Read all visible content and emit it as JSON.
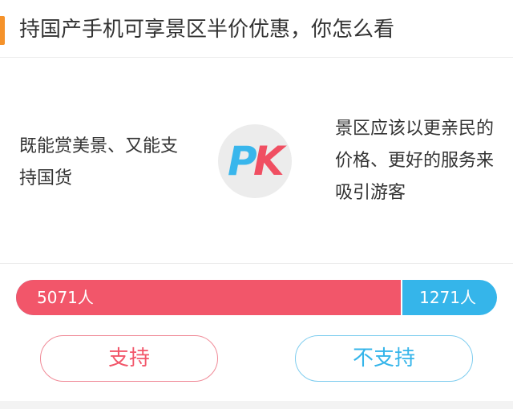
{
  "header": {
    "title": "持国产手机可享景区半价优惠，你怎么看",
    "accent_color": "#f5922a"
  },
  "pk": {
    "left_text": "既能赏美景、又能支持国货",
    "right_text": "景区应该以更亲民的价格、更好的服务来吸引游客",
    "badge_letter_p": "P",
    "badge_letter_k": "K"
  },
  "votes": {
    "support_count": 5071,
    "oppose_count": 1271,
    "support_label": "5071人",
    "oppose_label": "1271人",
    "support_color": "#f2566a",
    "oppose_color": "#35b5ea"
  },
  "buttons": {
    "support_label": "支持",
    "oppose_label": "不支持"
  }
}
